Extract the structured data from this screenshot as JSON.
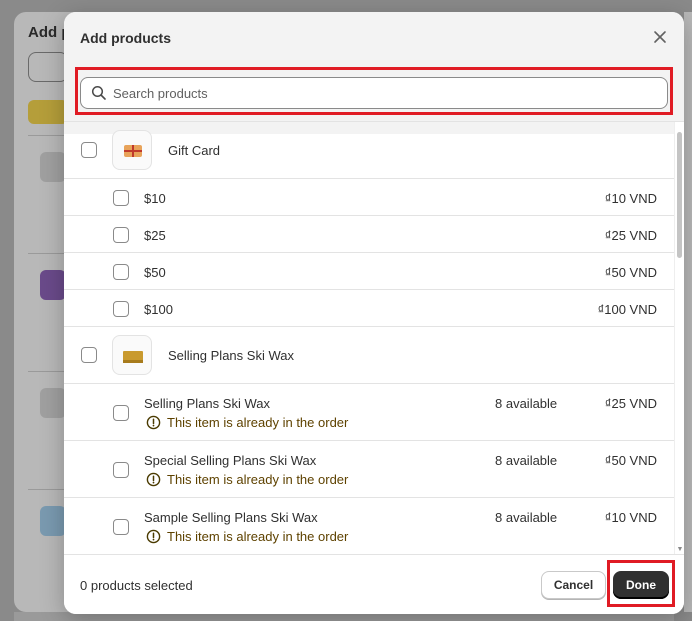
{
  "modal": {
    "title": "Add products",
    "search": {
      "placeholder": "Search products",
      "value": ""
    },
    "footer": {
      "selected_text": "0 products selected",
      "cancel_label": "Cancel",
      "done_label": "Done"
    }
  },
  "products": [
    {
      "name": "Gift Card",
      "thumb_icon": "gift-card-image",
      "variants": [
        {
          "name": "$10",
          "price": "₫10 VND"
        },
        {
          "name": "$25",
          "price": "₫25 VND"
        },
        {
          "name": "$50",
          "price": "₫50 VND"
        },
        {
          "name": "$100",
          "price": "₫100 VND"
        }
      ]
    },
    {
      "name": "Selling Plans Ski Wax",
      "thumb_icon": "ski-wax-image",
      "variants": [
        {
          "name": "Selling Plans Ski Wax",
          "availability": "8 available",
          "price": "₫25 VND",
          "warning": "This item is already in the order"
        },
        {
          "name": "Special Selling Plans Ski Wax",
          "availability": "8 available",
          "price": "₫50 VND",
          "warning": "This item is already in the order"
        },
        {
          "name": "Sample Selling Plans Ski Wax",
          "availability": "8 available",
          "price": "₫10 VND",
          "warning": "This item is already in the order"
        }
      ]
    }
  ],
  "colors": {
    "highlight": "#e01b24",
    "warning_text": "#5e4200",
    "primary_button": "#303030"
  }
}
